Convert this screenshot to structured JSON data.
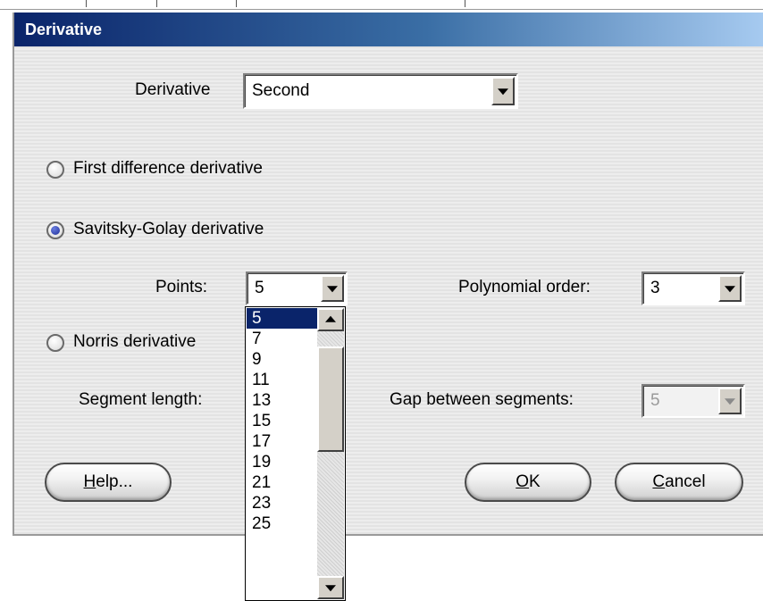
{
  "dialog": {
    "title": "Derivative",
    "derivative_label": "Derivative",
    "derivative_value": "Second",
    "options": {
      "first_difference": "First difference derivative",
      "savitsky_golay": "Savitsky-Golay derivative",
      "norris": "Norris derivative",
      "selected": "savitsky_golay"
    },
    "points_label": "Points:",
    "points_value": "5",
    "polynomial_label": "Polynomial order:",
    "polynomial_value": "3",
    "segment_label": "Segment length:",
    "gap_label": "Gap between segments:",
    "gap_value": "5",
    "buttons": {
      "help_mnemonic": "H",
      "help_rest": "elp...",
      "ok_mnemonic": "O",
      "ok_rest": "K",
      "cancel_mnemonic": "C",
      "cancel_rest": "ancel"
    }
  },
  "points_dropdown": {
    "items": [
      "5",
      "7",
      "9",
      "11",
      "13",
      "15",
      "17",
      "19",
      "21",
      "23",
      "25"
    ],
    "selected": "5"
  },
  "colors": {
    "title_start": "#0a246a",
    "title_end": "#a6caf0",
    "selection": "#0a246a"
  }
}
